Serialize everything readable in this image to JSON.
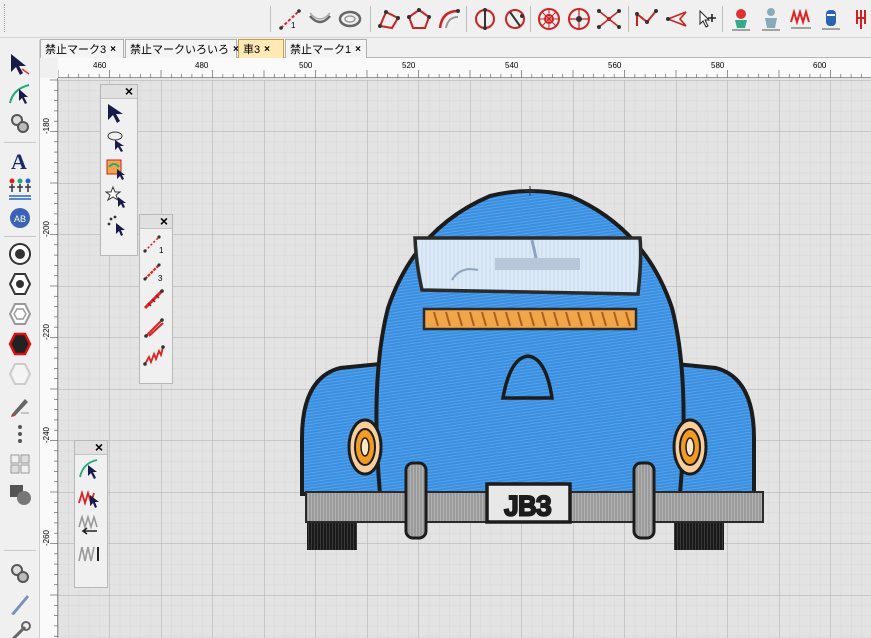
{
  "tabs": [
    {
      "label": "禁止マーク3",
      "active": false
    },
    {
      "label": "禁止マークいろいろ",
      "active": false
    },
    {
      "label": "車3",
      "active": true
    },
    {
      "label": "禁止マーク1",
      "active": false
    }
  ],
  "tab_close_glyph": "×",
  "ruler": {
    "horizontal_labels": [
      "460",
      "480",
      "500",
      "520",
      "540",
      "560",
      "580",
      "600"
    ],
    "vertical_labels": [
      "-180",
      "-200",
      "-220",
      "-240",
      "-260"
    ]
  },
  "palettes": {
    "select_tools": {
      "close_glyph": "×",
      "tools": [
        "select-arrow-icon",
        "lasso-select-icon",
        "select-object-color-icon",
        "star-select-icon",
        "point-select-icon"
      ]
    },
    "running_stitch_tools": {
      "close_glyph": "×",
      "tools": [
        "running-stitch-1-icon",
        "running-stitch-3-icon",
        "bean-stitch-icon",
        "satin-line-icon",
        "zigzag-line-icon"
      ]
    },
    "stitch_edit_tools": {
      "close_glyph": "×",
      "tools": [
        "stitch-edit-arrow-icon",
        "stitch-select-red-icon",
        "stitch-insert-icon",
        "stitch-trim-icon"
      ]
    }
  },
  "toolbar_icons": [
    "running-line-icon",
    "arc-line-icon",
    "ring-icon",
    "polygon-node-icon",
    "pentagon-node-icon",
    "curve-node-icon",
    "circle-split-icon",
    "crescent-split-icon",
    "wheel-icon",
    "target-icon",
    "fan-icon",
    "zigzag-node-icon",
    "flag-icon",
    "add-node-icon",
    "plant-icon",
    "figure-icon",
    "wave-icon",
    "bottle-icon",
    "fork-icon"
  ],
  "left_icons": [
    "select-pointer-icon",
    "node-edit-icon",
    "reshape-icon",
    "text-icon",
    "people-icon",
    "monogram-icon",
    "circle-fill-icon",
    "hexagon-outline-icon",
    "hexagon-bevel-icon",
    "hexagon-red-icon",
    "hexagon-white-icon",
    "pen-icon",
    "dots-icon",
    "grid-icon",
    "shape-icon",
    "reshape-2-icon",
    "knife-icon",
    "wrench-icon"
  ],
  "design": {
    "license_plate": "JB3"
  },
  "colors": {
    "car_blue": "#3a8fe0",
    "car_outline": "#1c1c1c",
    "headlight_orange": "#f2a64a",
    "bumper_grey": "#8f8f8f",
    "tab_active_bg": "#ffe9b5",
    "canvas_bg": "#e3e3e3",
    "grid_line": "#ababab"
  }
}
